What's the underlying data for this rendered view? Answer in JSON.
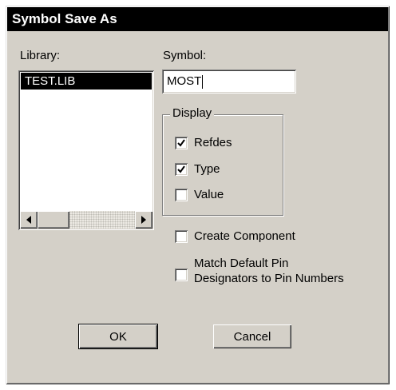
{
  "window": {
    "title": "Symbol Save As"
  },
  "library": {
    "label": "Library:",
    "items": [
      {
        "label": "TEST.LIB",
        "selected": true
      }
    ],
    "scroll_left_icon": "triangle-left",
    "scroll_right_icon": "triangle-right"
  },
  "symbol": {
    "label": "Symbol:",
    "value": "MOST"
  },
  "display": {
    "legend": "Display",
    "options": [
      {
        "label": "Refdes",
        "checked": true
      },
      {
        "label": "Type",
        "checked": true
      },
      {
        "label": "Value",
        "checked": false
      }
    ]
  },
  "create_component": {
    "label": "Create Component",
    "checked": false
  },
  "match_pins": {
    "line1": "Match Default Pin",
    "line2": "Designators to Pin Numbers",
    "checked": false
  },
  "buttons": {
    "ok": "OK",
    "cancel": "Cancel"
  },
  "colors": {
    "face": "#d4d0c8",
    "title_bar": "#000000",
    "selection": "#000000"
  }
}
